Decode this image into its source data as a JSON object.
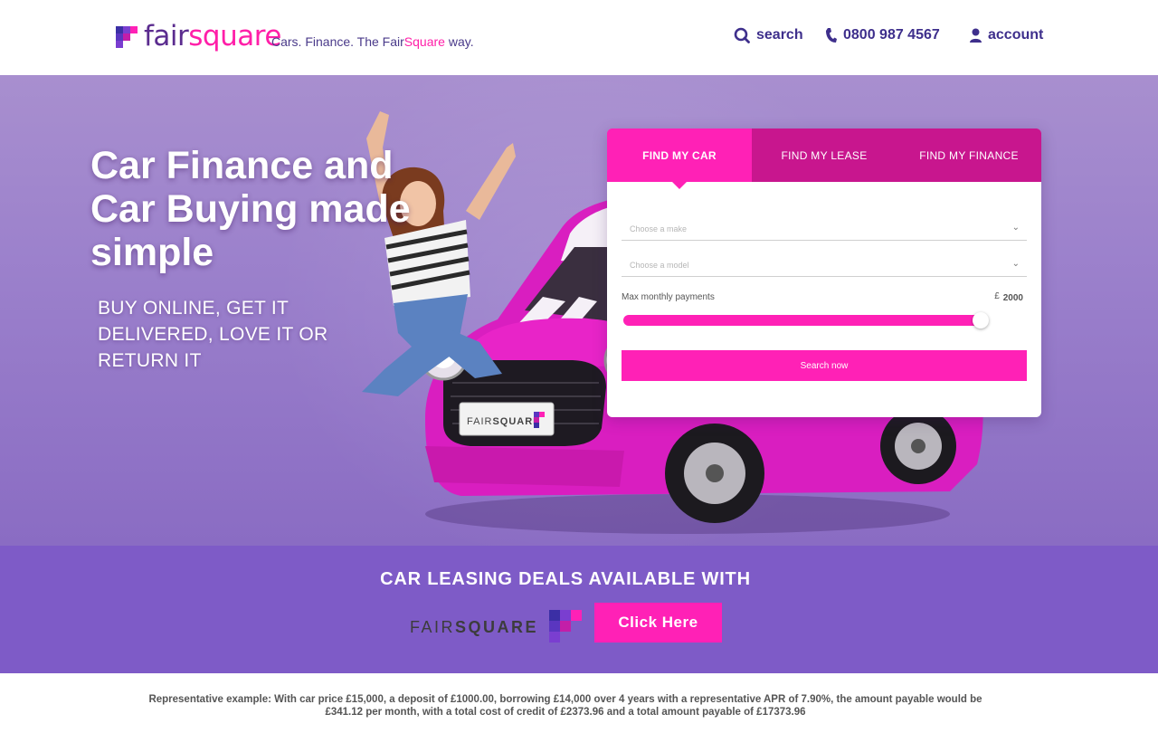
{
  "header": {
    "logo": {
      "fair": "fair",
      "square": "square"
    },
    "tagline": {
      "prefix": "Cars. Finance. The Fair",
      "highlight": "Square",
      "suffix": " way."
    },
    "nav": {
      "search_label": "search",
      "phone_label": "0800 987 4567",
      "account_label": "account"
    }
  },
  "hero": {
    "title": "Car Finance and Car Buying made simple",
    "subtitle": "BUY ONLINE, GET IT DELIVERED, LOVE IT OR RETURN IT",
    "plate": {
      "fair": "FAIR",
      "square": "SQUARE"
    }
  },
  "finder": {
    "tabs": [
      {
        "label": "FIND MY CAR",
        "active": true
      },
      {
        "label": "FIND MY LEASE",
        "active": false
      },
      {
        "label": "FIND MY FINANCE",
        "active": false
      }
    ],
    "make_placeholder": "Choose a make",
    "model_placeholder": "Choose a model",
    "budget_label": "Max monthly payments",
    "currency": "£",
    "budget_value": "2000",
    "budget_fraction": 1.0,
    "search_label": "Search now"
  },
  "banner": {
    "title": "CAR LEASING DEALS AVAILABLE WITH",
    "logo_fair": "FAIR",
    "logo_square": "SQUARE",
    "button_label": "Click Here"
  },
  "disclaimer": "Representative example: With car price £15,000, a deposit of £1000.00, borrowing £14,000 over 4 years with a representative APR of 7.90%, the amount payable would be £341.12 per month, with a total cost of credit of £2373.96 and a total amount payable of £17373.96",
  "colors": {
    "brand_pink": "#ff21b6",
    "brand_purple": "#5b2c8f",
    "banner_purple": "#7e5bc7",
    "tab_dark": "#c8168e"
  }
}
